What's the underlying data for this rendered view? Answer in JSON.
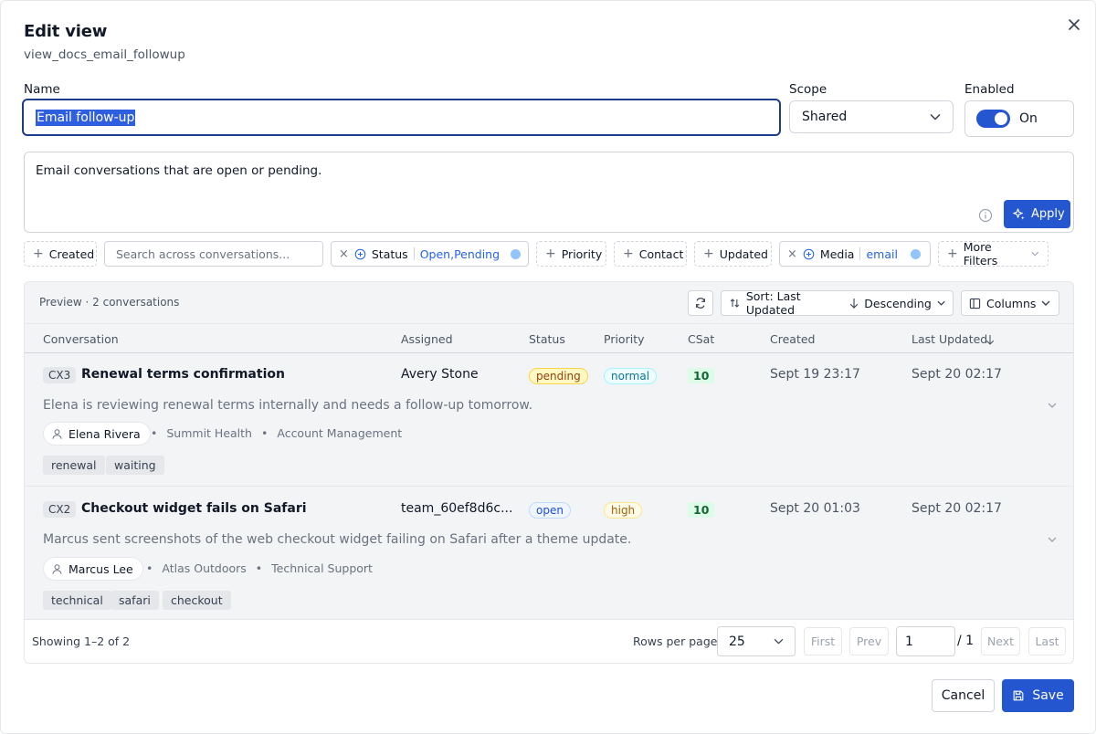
{
  "dialog": {
    "title": "Edit view",
    "subtitle": "view_docs_email_followup"
  },
  "form": {
    "name_label": "Name",
    "name_value": "Email follow-up",
    "scope_label": "Scope",
    "scope_value": "Shared",
    "enabled_label": "Enabled",
    "enabled_state": "On",
    "description": "Email conversations that are open or pending.",
    "apply_label": "Apply"
  },
  "filters": {
    "created": "Created",
    "search_placeholder": "Search across conversations...",
    "status_label": "Status",
    "status_value": "Open,Pending",
    "priority": "Priority",
    "contact": "Contact",
    "updated": "Updated",
    "media_label": "Media",
    "media_value": "email",
    "more": "More Filters"
  },
  "table": {
    "preview": "Preview · 2 conversations",
    "sort_label": "Sort: Last Updated",
    "sort_dir": "Descending",
    "columns_label": "Columns",
    "headers": [
      "Conversation",
      "Assigned",
      "Status",
      "Priority",
      "CSat",
      "Created",
      "Last Updated"
    ],
    "rows": [
      {
        "id": "CX3",
        "title": "Renewal terms confirmation",
        "assigned": "Avery Stone",
        "status": "pending",
        "priority": "normal",
        "csat": "10",
        "created": "Sept 19 23:17",
        "updated": "Sept 20 02:17",
        "summary": "Elena is reviewing renewal terms internally and needs a follow-up tomorrow.",
        "contact": "Elena Rivera",
        "org": "Summit Health",
        "team": "Account Management",
        "tags": [
          "renewal",
          "waiting"
        ]
      },
      {
        "id": "CX2",
        "title": "Checkout widget fails on Safari",
        "assigned": "team_60ef8d6c...",
        "status": "open",
        "priority": "high",
        "csat": "10",
        "created": "Sept 20 01:03",
        "updated": "Sept 20 02:17",
        "summary": "Marcus sent screenshots of the web checkout widget failing on Safari after a theme update.",
        "contact": "Marcus Lee",
        "org": "Atlas Outdoors",
        "team": "Technical Support",
        "tags": [
          "technical",
          "safari",
          "checkout"
        ]
      }
    ]
  },
  "pager": {
    "showing": "Showing 1–2 of 2",
    "rows_label": "Rows per page",
    "rows_value": "25",
    "first": "First",
    "prev": "Prev",
    "page": "1",
    "total": "/ 1",
    "next": "Next",
    "last": "Last"
  },
  "footer": {
    "cancel": "Cancel",
    "save": "Save"
  },
  "colors": {
    "primary": "#2456cf",
    "focus_border": "#1e3a8a",
    "link": "#2563eb"
  }
}
